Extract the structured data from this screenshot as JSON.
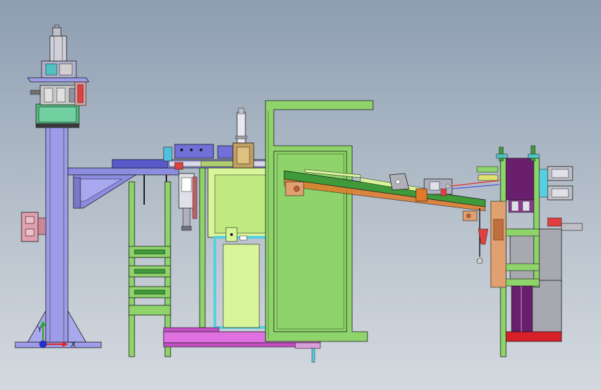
{
  "viewport": {
    "background_top": "#8d9eb2",
    "background_bottom": "#d4d9df"
  },
  "triad": {
    "x_label": "X",
    "y_label": "Y",
    "x_color": "#e02020",
    "y_color": "#20b020",
    "z_color": "#2030e0"
  },
  "palette": {
    "frame_green": "#8ed46a",
    "panel_lime": "#d8f59a",
    "column_blue": "#9c9ce8",
    "arm_blue": "#8c8ce0",
    "cyan_frame": "#55d0e0",
    "base_magenta": "#e070e0",
    "tower_purple": "#6a1e6e",
    "conveyor_green": "#3f9a3a",
    "rail_orange": "#e07a2a",
    "red_base": "#d8202a",
    "cabinet_gray": "#a8a8b0",
    "outline": "#1a1a1a"
  }
}
